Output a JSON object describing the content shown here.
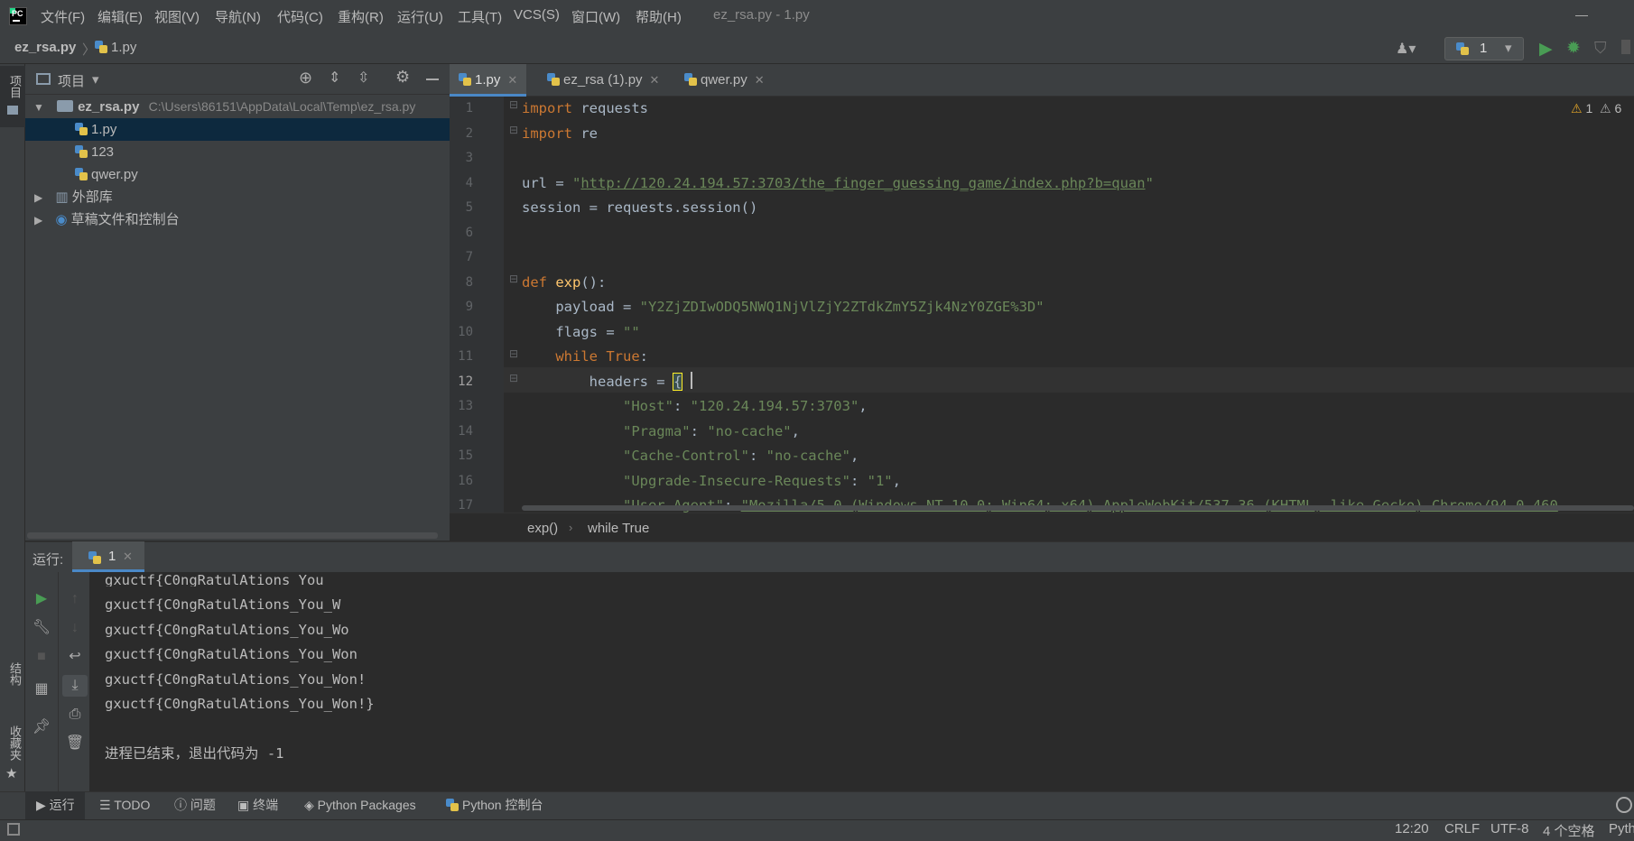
{
  "menu": [
    "文件(F)",
    "编辑(E)",
    "视图(V)",
    "导航(N)",
    "代码(C)",
    "重构(R)",
    "运行(U)",
    "工具(T)",
    "VCS(S)",
    "窗口(W)",
    "帮助(H)"
  ],
  "window_title": "ez_rsa.py - 1.py",
  "nav": {
    "project": "ez_rsa.py",
    "file": "1.py",
    "run_config": "1"
  },
  "left_stripe": {
    "project": "项目",
    "structure": "结构",
    "favorites": "收藏夹"
  },
  "project_panel": {
    "title": "项目",
    "root": {
      "name": "ez_rsa.py",
      "path": "C:\\Users\\86151\\AppData\\Local\\Temp\\ez_rsa.py"
    },
    "files": [
      "1.py",
      "123",
      "qwer.py"
    ],
    "external": "外部库",
    "scratches": "草稿文件和控制台"
  },
  "editor": {
    "tabs": [
      "1.py",
      "ez_rsa (1).py",
      "qwer.py"
    ],
    "warnings": {
      "errors": "1",
      "warnings": "6"
    },
    "line_numbers": [
      "1",
      "2",
      "3",
      "4",
      "5",
      "6",
      "7",
      "8",
      "9",
      "10",
      "11",
      "12",
      "13",
      "14",
      "15",
      "16",
      "17"
    ],
    "breadcrumb": [
      "exp()",
      "while True"
    ],
    "code": {
      "l4_url": "http://120.24.194.57:3703/the_finger_guessing_game/index.php?b=quan",
      "l9_payload": "\"Y2ZjZDIwODQ5NWQ1NjVlZjY2ZTdkZmY5Zjk4NzY0ZGE%3D\"",
      "l13_val": "\"120.24.194.57:3703\"",
      "l17_val": "\"Mozilla/5.0 (Windows NT 10.0; Win64; x64) AppleWebKit/537.36 (KHTML, like Gecko) Chrome/94.0.460"
    }
  },
  "run": {
    "label": "运行:",
    "tab": "1",
    "output": [
      "gxuctf{C0ngRatulAtions_You_",
      "gxuctf{C0ngRatulAtions_You_W",
      "gxuctf{C0ngRatulAtions_You_Wo",
      "gxuctf{C0ngRatulAtions_You_Won",
      "gxuctf{C0ngRatulAtions_You_Won!",
      "gxuctf{C0ngRatulAtions_You_Won!}"
    ],
    "exit": "进程已结束，退出代码为 -1"
  },
  "bottom_tabs": [
    "运行",
    "TODO",
    "问题",
    "终端",
    "Python Packages",
    "Python 控制台"
  ],
  "status": {
    "position": "12:20",
    "line_sep": "CRLF",
    "encoding": "UTF-8",
    "indent": "4 个空格",
    "interpreter": "Pyth"
  }
}
